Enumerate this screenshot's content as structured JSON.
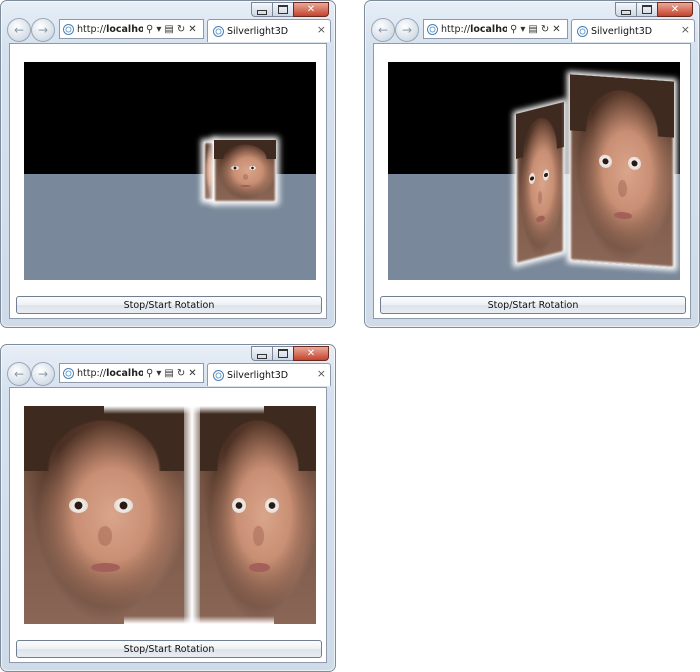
{
  "windows": [
    {
      "id": "w1",
      "address": {
        "prefix": "http://",
        "host": "localhost:"
      },
      "tab_title": "Silverlight3D",
      "button_label": "Stop/Start Rotation"
    },
    {
      "id": "w2",
      "address": {
        "prefix": "http://",
        "host": "localhost:"
      },
      "tab_title": "Silverlight3D",
      "button_label": "Stop/Start Rotation"
    },
    {
      "id": "w3",
      "address": {
        "prefix": "http://",
        "host": "localhost:"
      },
      "tab_title": "Silverlight3D",
      "button_label": "Stop/Start Rotation"
    }
  ],
  "icons": {
    "back": "back-arrow-icon",
    "forward": "forward-arrow-icon",
    "search": "search-icon",
    "compat": "compatibility-view-icon",
    "refresh": "refresh-icon",
    "stop": "stop-icon",
    "close_tab": "close-tab-icon",
    "page": "ie-page-icon"
  },
  "colors": {
    "sky": "#000000",
    "floor": "#79889a"
  }
}
